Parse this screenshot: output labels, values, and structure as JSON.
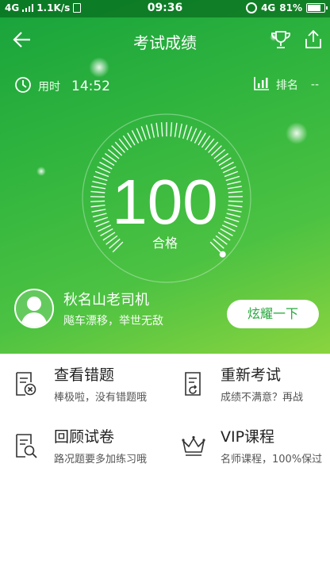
{
  "status_bar": {
    "network": "4G",
    "speed": "1.1K/s",
    "time": "09:36",
    "network_right": "4G",
    "battery": "81%"
  },
  "header": {
    "title": "考试成绩",
    "back_icon": "back-arrow-icon",
    "trophy_icon": "trophy-icon",
    "share_icon": "share-icon"
  },
  "stats": {
    "time_label": "用时",
    "time_value": "14:52",
    "rank_label": "排名",
    "rank_value": "--"
  },
  "score": {
    "value": "100",
    "result": "合格",
    "gauge_fill_fraction": 1.0
  },
  "user": {
    "name": "秋名山老司机",
    "motto": "飚车漂移，举世无敌"
  },
  "share_button": {
    "label": "炫耀一下"
  },
  "menu": [
    {
      "title": "查看错题",
      "subtitle": "棒极啦，没有错题哦",
      "icon": "wrong-answers-icon"
    },
    {
      "title": "重新考试",
      "subtitle": "成绩不满意？再战",
      "icon": "retake-exam-icon"
    },
    {
      "title": "回顾试卷",
      "subtitle": "路况题要多加练习哦",
      "icon": "review-paper-icon"
    },
    {
      "title": "VIP课程",
      "subtitle": "名师课程，100%保过",
      "icon": "vip-crown-icon"
    }
  ],
  "colors": {
    "primary_green": "#2fb43e",
    "accent_text": "#27a83c"
  }
}
